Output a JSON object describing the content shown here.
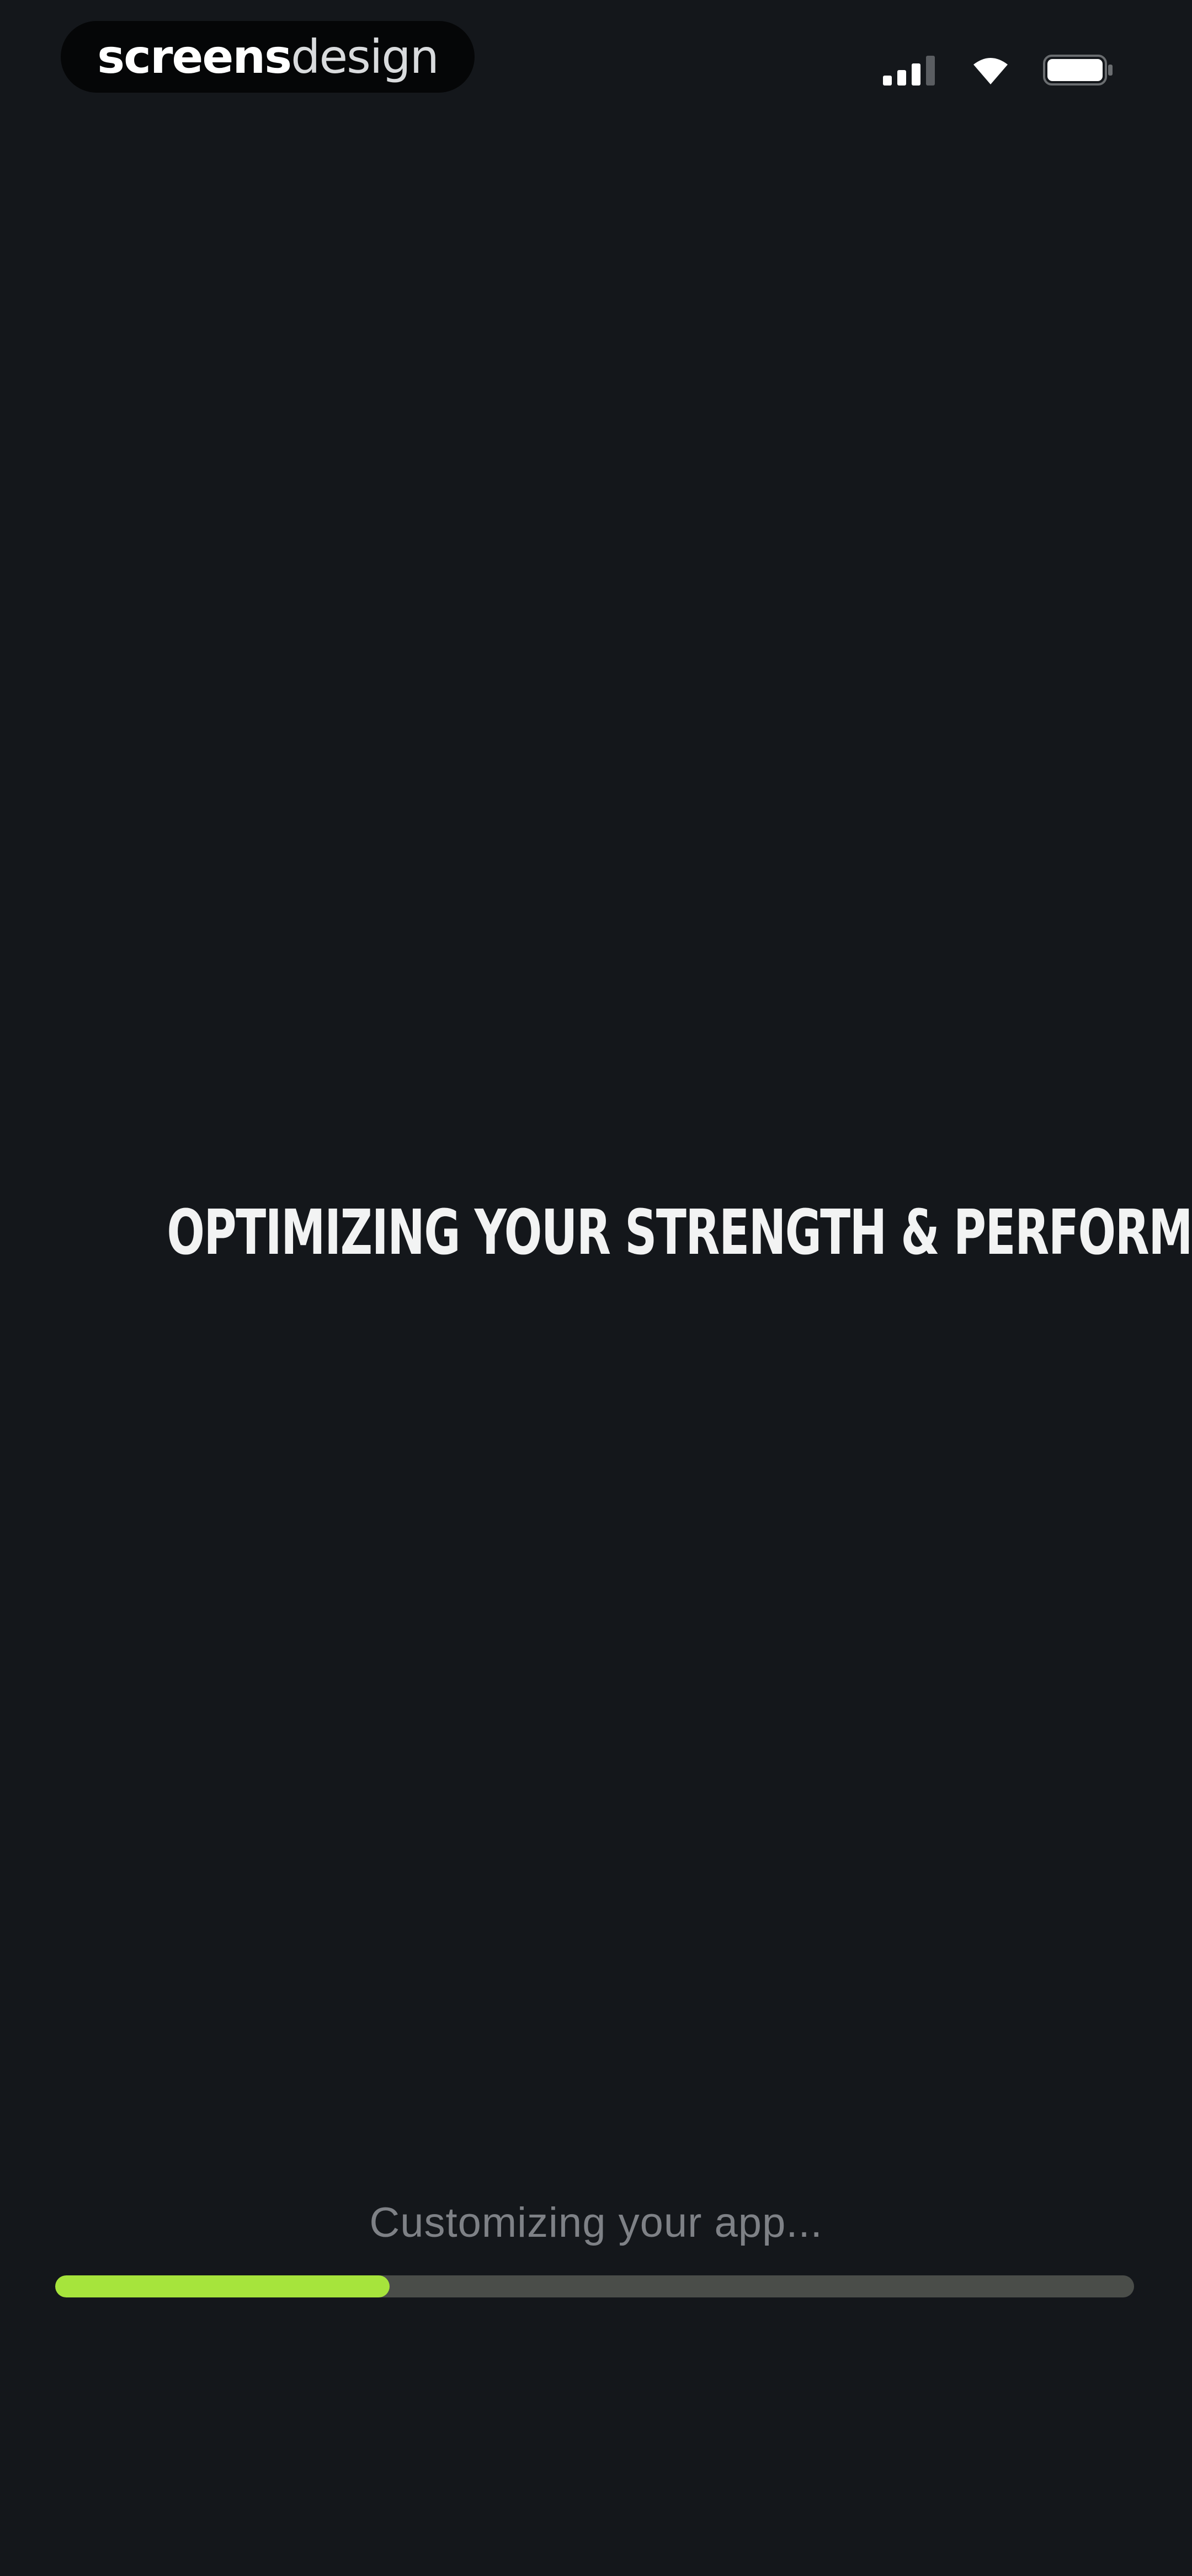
{
  "watermark": {
    "bold_part": "screens",
    "light_part": "design"
  },
  "status_bar": {
    "icons": [
      "signal-icon",
      "wifi-icon",
      "battery-icon"
    ]
  },
  "main": {
    "headline": "OPTIMIZING YOUR STRENGTH & PERFORMANCE..."
  },
  "progress": {
    "label": "Customizing your app...",
    "fraction": 0.31
  },
  "colors": {
    "background": "#14171b",
    "accent": "#a6e43c",
    "track": "#4a4d49",
    "label": "#7e8186"
  }
}
